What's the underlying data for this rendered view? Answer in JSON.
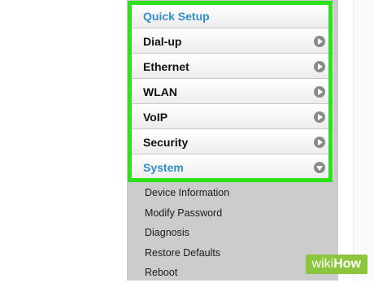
{
  "menu": {
    "items": [
      {
        "label": "Quick Setup",
        "style": "link"
      },
      {
        "label": "Dial-up",
        "style": "normal",
        "icon": "chevron-right-icon"
      },
      {
        "label": "Ethernet",
        "style": "normal",
        "icon": "chevron-right-icon"
      },
      {
        "label": "WLAN",
        "style": "normal",
        "icon": "chevron-right-icon"
      },
      {
        "label": "VoIP",
        "style": "normal",
        "icon": "chevron-right-icon"
      },
      {
        "label": "Security",
        "style": "normal",
        "icon": "chevron-right-icon"
      },
      {
        "label": "System",
        "style": "link",
        "icon": "chevron-down-icon",
        "expanded": true
      }
    ]
  },
  "submenu": {
    "items": [
      "Device Information",
      "Modify Password",
      "Diagnosis",
      "Restore Defaults",
      "Reboot"
    ]
  },
  "watermark": {
    "wiki": "wiki",
    "how": "How"
  },
  "colors": {
    "highlight": "#2ee21a",
    "link": "#2f8fc6",
    "sidebar_bg": "#cccccc",
    "watermark_bg": "#8cc63f"
  }
}
